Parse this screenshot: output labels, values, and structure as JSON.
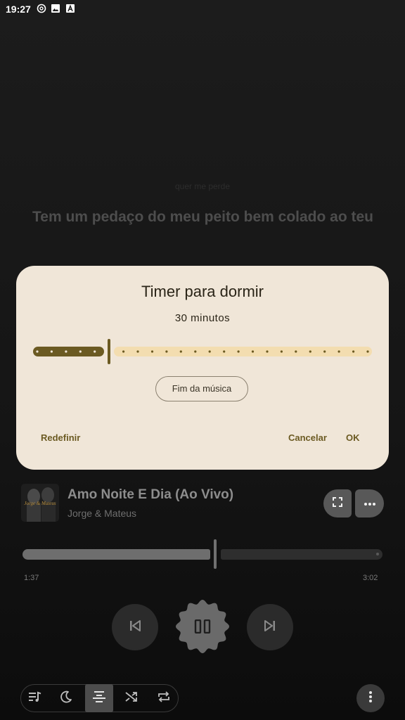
{
  "status_bar": {
    "time": "19:27",
    "icons": [
      "at-sign-icon",
      "image-icon",
      "text-a-icon"
    ]
  },
  "lyrics": {
    "previous_line": "quer me perde",
    "current_line": "Tem um pedaço do meu peito bem colado ao teu"
  },
  "sleep_timer_dialog": {
    "title": "Timer para dormir",
    "value_label": "30 minutos",
    "slider_fraction": 0.2,
    "end_of_song_label": "Fim da música",
    "reset_label": "Redefinir",
    "cancel_label": "Cancelar",
    "ok_label": "OK"
  },
  "now_playing": {
    "album_art_text": "Jorge & Mateus",
    "title": "Amo Noite E Dia (Ao Vivo)",
    "artist": "Jorge & Mateus",
    "elapsed": "1:37",
    "duration": "3:02",
    "progress_fraction": 0.53
  },
  "colors": {
    "dialog_background": "#f0e6d8",
    "accent": "#6b5a22",
    "slider_track": "#f3ddb0"
  }
}
